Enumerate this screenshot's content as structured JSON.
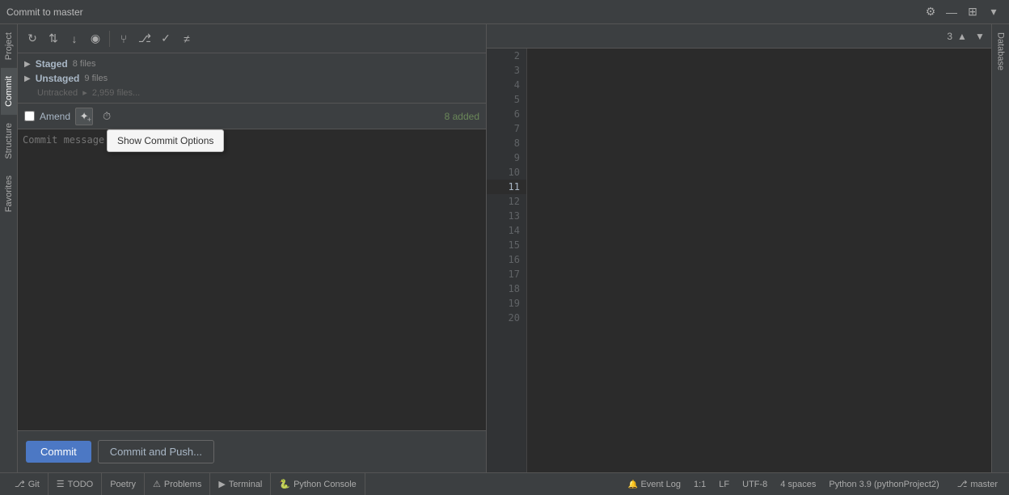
{
  "titleBar": {
    "title": "Commit to master",
    "settingsIcon": "⚙",
    "minimizeIcon": "—",
    "expandIcon": "⊞",
    "chevronIcon": "▾"
  },
  "toolbar": {
    "refreshIcon": "↻",
    "updateIcon": "⇅",
    "fetchIcon": "↓",
    "eyeIcon": "◉",
    "branchIcon": "⑂",
    "mergeIcon": "⎇",
    "resolveIcon": "✓",
    "diffIcon": "≠"
  },
  "fileGroups": {
    "staged": {
      "label": "Staged",
      "count": "8 files"
    },
    "unstaged": {
      "label": "Unstaged",
      "count": "9 files"
    },
    "untracked": {
      "label": "Untracked"
    }
  },
  "amendRow": {
    "checkboxLabel": "Amend",
    "addedBadge": "8 added",
    "gearIcon": "✦",
    "historyIcon": "⏱"
  },
  "tooltip": {
    "text": "Show Commit Options"
  },
  "commitButtons": {
    "commitLabel": "Commit",
    "commitPushLabel": "Commit and Push..."
  },
  "lineNumbers": [
    2,
    3,
    4,
    5,
    6,
    7,
    8,
    9,
    10,
    11,
    12,
    13,
    14,
    15,
    16,
    17,
    18,
    19,
    20
  ],
  "activeLineNumber": 11,
  "editorHeader": {
    "lineCount": "3"
  },
  "statusBar": {
    "tabs": [
      {
        "id": "git",
        "icon": "⎇",
        "label": "Git"
      },
      {
        "id": "todo",
        "icon": "☰",
        "label": "TODO"
      },
      {
        "id": "poetry",
        "icon": "",
        "label": "Poetry"
      },
      {
        "id": "problems",
        "icon": "⚠",
        "label": "Problems"
      },
      {
        "id": "terminal",
        "icon": "▶",
        "label": "Terminal"
      },
      {
        "id": "python-console",
        "icon": "🐍",
        "label": "Python Console"
      }
    ],
    "right": {
      "position": "1:1",
      "lineEnding": "LF",
      "encoding": "UTF-8",
      "indent": "4 spaces",
      "interpreter": "Python 3.9 (pythonProject2)",
      "branch": "master",
      "eventLog": "Event Log"
    }
  },
  "leftSidebar": {
    "project": "Project",
    "commit": "Commit",
    "structure": "Structure",
    "favorites": "Favorites"
  },
  "rightSidebar": {
    "database": "Database"
  }
}
